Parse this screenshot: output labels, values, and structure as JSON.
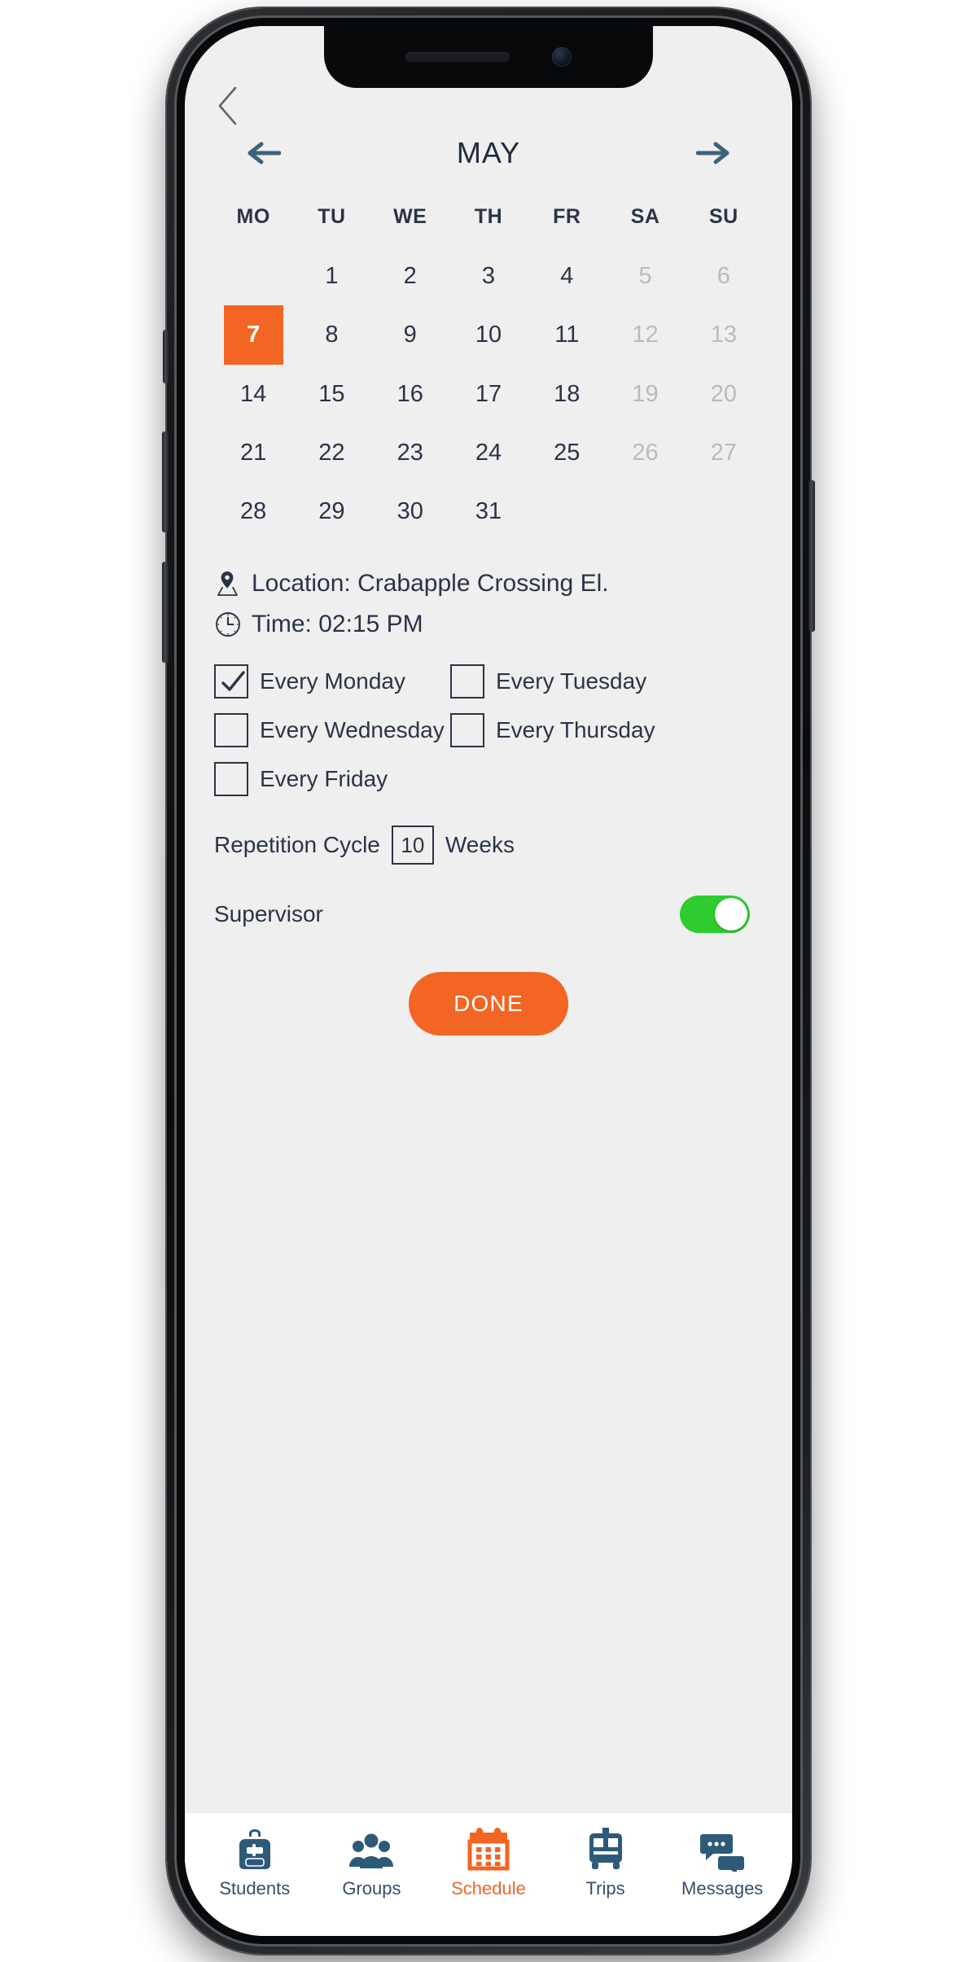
{
  "app": {
    "accent_orange": "#F26522",
    "ink_navy": "#2B3446",
    "screen_bg": "#EFEFEF",
    "toggle_green": "#2ECC2E",
    "muted_grey": "#B9BBBE"
  },
  "header": {
    "back_label": "Back",
    "prev_label": "Previous month",
    "next_label": "Next month",
    "month": "MAY"
  },
  "calendar": {
    "weekdays": [
      "MO",
      "TU",
      "WE",
      "TH",
      "FR",
      "SA",
      "SU"
    ],
    "selected_day": "7",
    "leading_blanks": 1,
    "weeks": [
      [
        {
          "label": "",
          "state": "empty"
        },
        {
          "label": "1",
          "state": "normal"
        },
        {
          "label": "2",
          "state": "normal"
        },
        {
          "label": "3",
          "state": "normal"
        },
        {
          "label": "4",
          "state": "normal"
        },
        {
          "label": "5",
          "state": "muted"
        },
        {
          "label": "6",
          "state": "muted"
        }
      ],
      [
        {
          "label": "7",
          "state": "selected"
        },
        {
          "label": "8",
          "state": "normal"
        },
        {
          "label": "9",
          "state": "normal"
        },
        {
          "label": "10",
          "state": "normal"
        },
        {
          "label": "11",
          "state": "normal"
        },
        {
          "label": "12",
          "state": "muted"
        },
        {
          "label": "13",
          "state": "muted"
        }
      ],
      [
        {
          "label": "14",
          "state": "normal"
        },
        {
          "label": "15",
          "state": "normal"
        },
        {
          "label": "16",
          "state": "normal"
        },
        {
          "label": "17",
          "state": "normal"
        },
        {
          "label": "18",
          "state": "normal"
        },
        {
          "label": "19",
          "state": "muted"
        },
        {
          "label": "20",
          "state": "muted"
        }
      ],
      [
        {
          "label": "21",
          "state": "normal"
        },
        {
          "label": "22",
          "state": "normal"
        },
        {
          "label": "23",
          "state": "normal"
        },
        {
          "label": "24",
          "state": "normal"
        },
        {
          "label": "25",
          "state": "normal"
        },
        {
          "label": "26",
          "state": "muted"
        },
        {
          "label": "27",
          "state": "muted"
        }
      ],
      [
        {
          "label": "28",
          "state": "normal"
        },
        {
          "label": "29",
          "state": "normal"
        },
        {
          "label": "30",
          "state": "normal"
        },
        {
          "label": "31",
          "state": "normal"
        },
        {
          "label": "",
          "state": "empty"
        },
        {
          "label": "",
          "state": "empty"
        },
        {
          "label": "",
          "state": "empty"
        }
      ]
    ]
  },
  "details": {
    "location_icon": "map-pin-icon",
    "location_text": "Location: Crabapple Crossing El.",
    "time_icon": "clock-icon",
    "time_text": "Time: 02:15 PM"
  },
  "recurrence": {
    "options": [
      {
        "label": "Every Monday",
        "checked": true
      },
      {
        "label": "Every Tuesday",
        "checked": false
      },
      {
        "label": "Every Wednesday",
        "checked": false
      },
      {
        "label": "Every Thursday",
        "checked": false
      },
      {
        "label": "Every Friday",
        "checked": false
      }
    ]
  },
  "repetition": {
    "label": "Repetition Cycle",
    "value": "10",
    "unit": "Weeks"
  },
  "supervisor": {
    "label": "Supervisor",
    "enabled": true
  },
  "primary_action": {
    "label": "DONE"
  },
  "tabbar": {
    "items": [
      {
        "label": "Students",
        "icon": "backpack-icon",
        "active": false
      },
      {
        "label": "Groups",
        "icon": "people-group-icon",
        "active": false
      },
      {
        "label": "Schedule",
        "icon": "calendar-icon",
        "active": true
      },
      {
        "label": "Trips",
        "icon": "bus-icon",
        "active": false
      },
      {
        "label": "Messages",
        "icon": "chat-bubbles-icon",
        "active": false
      }
    ]
  }
}
